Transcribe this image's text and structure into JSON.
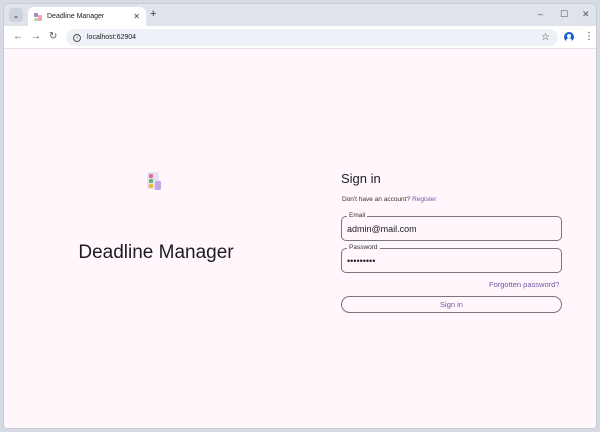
{
  "browser": {
    "tab_menu_icon": "chevron-down-icon",
    "tab_title": "Deadline Manager",
    "tab_close": "✕",
    "new_tab": "+",
    "minimize": "–",
    "maximize": "☐",
    "close": "✕",
    "back": "←",
    "forward": "→",
    "reload": "↻",
    "url": "localhost:62904",
    "star": "☆",
    "menu": "⋮"
  },
  "app": {
    "title": "Deadline Manager"
  },
  "signin": {
    "title": "Sign in",
    "no_account": "Don't have an account?",
    "register": "Register",
    "email_label": "Email",
    "email_value": "admin@mail.com",
    "password_label": "Password",
    "password_value": "•••••••••",
    "forgot": "Forgotten password?",
    "submit": "Sign in"
  },
  "colors": {
    "page_background": "#fff7fc",
    "accent": "#6b5aa5"
  }
}
